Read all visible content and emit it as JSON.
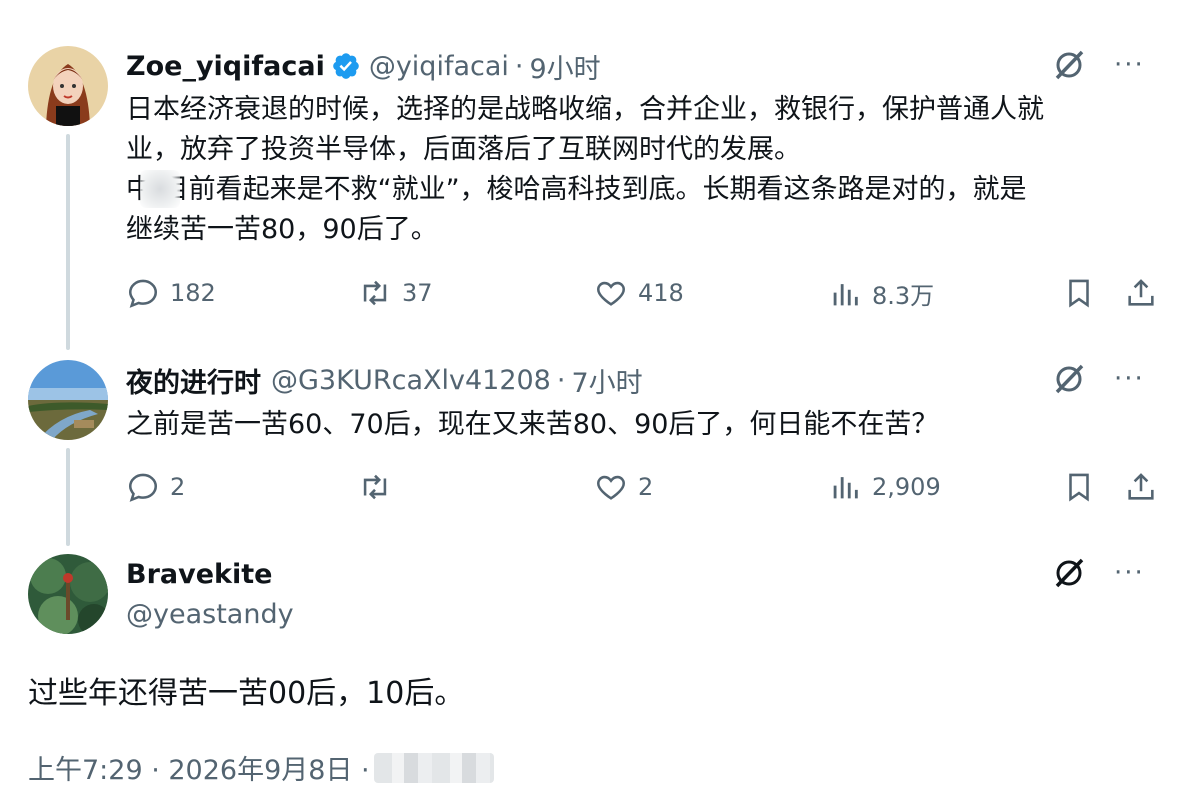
{
  "tweets": [
    {
      "name": "Zoe_yiqifacai",
      "handle": "@yiqifacai",
      "dot": "·",
      "time": "9小时",
      "verified": true,
      "text": "日本经济衰退的时候，选择的是战略收缩，合并企业，救银行，保护普通人就\n业，放弃了投资半导体，后面落后了互联网时代的发展。\n中 目前看起来是不救“就业”，梭哈高科技到底。长期看这条路是对的，就是\n继续苦一苦80，90后了。",
      "replies": "182",
      "reposts": "37",
      "likes": "418",
      "views": "8.3万"
    },
    {
      "name": "夜的进行时",
      "handle": "@G3KURcaXlv41208",
      "dot": "·",
      "time": "7小时",
      "text": "之前是苦一苦60、70后，现在又来苦80、90后了，何日能不在苦？",
      "replies": "2",
      "reposts": "",
      "likes": "2",
      "views": "2,909"
    }
  ],
  "main_post": {
    "name": "Bravekite",
    "handle": "@yeastandy",
    "text": "过些年还得苦一苦00后，10后。",
    "timestamp": "上午7:29 · 2026年9月8日 ·"
  },
  "icons": {
    "grok": "grok-icon",
    "more": "more-icon",
    "reply": "reply-icon",
    "repost": "repost-icon",
    "like": "like-icon",
    "views": "views-icon",
    "bookmark": "bookmark-icon",
    "share": "share-icon"
  },
  "more_label": "···",
  "colors": {
    "verified": "#1d9bf0",
    "secondary_text": "#536471",
    "thread_line": "#cfd9de"
  }
}
